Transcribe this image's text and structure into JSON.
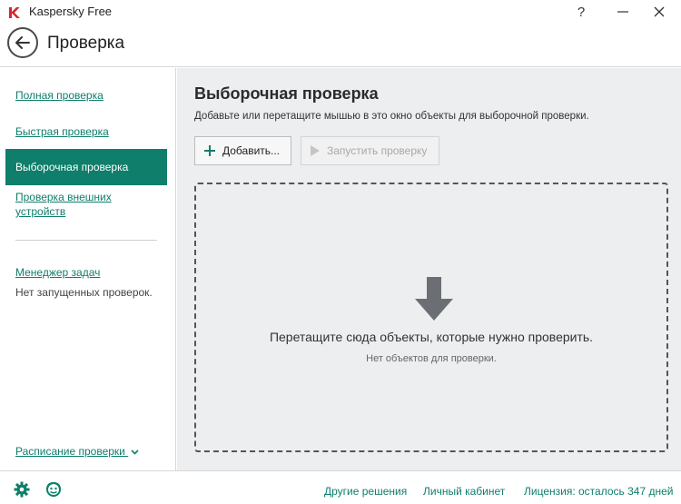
{
  "window": {
    "title": "Kaspersky Free",
    "help": "?",
    "minimize": "—",
    "close": "✕"
  },
  "header": {
    "title": "Проверка"
  },
  "sidebar": {
    "items": [
      {
        "label": "Полная проверка"
      },
      {
        "label": "Быстрая проверка"
      },
      {
        "label": "Выборочная проверка"
      },
      {
        "label_line1": "Проверка внешних",
        "label_line2": "устройств"
      }
    ],
    "task_manager": "Менеджер задач",
    "task_status": "Нет запущенных проверок.",
    "schedule": "Расписание проверки"
  },
  "main": {
    "title": "Выборочная проверка",
    "description": "Добавьте или перетащите мышью в это окно объекты для выборочной проверки.",
    "add_button": "Добавить...",
    "run_button": "Запустить проверку",
    "drop_text": "Перетащите сюда объекты, которые нужно проверить.",
    "drop_subtext": "Нет объектов для проверки."
  },
  "footer": {
    "other_solutions": "Другие решения",
    "account": "Личный кабинет",
    "license": "Лицензия: осталось 347 дней"
  },
  "colors": {
    "accent": "#0f7e6b",
    "brand_red": "#d7262d",
    "main_bg": "#eceef0"
  },
  "icons": {
    "logo": "kaspersky-k-logo",
    "back": "arrow-left-icon",
    "add": "plus-icon",
    "run": "play-icon",
    "drop": "arrow-down-icon",
    "settings": "gear-icon",
    "support": "support-icon"
  }
}
